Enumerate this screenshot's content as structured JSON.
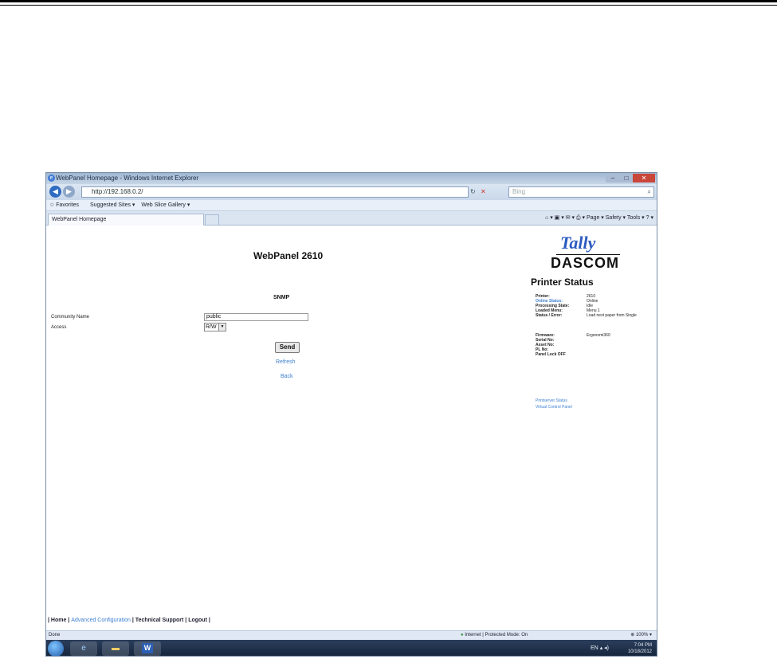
{
  "window": {
    "title": "WebPanel Homepage - Windows Internet Explorer"
  },
  "browser": {
    "address": "http://192.168.0.2/",
    "search_placeholder": "Bing",
    "favorites_label": "Favorites",
    "suggested_sites": "Suggested Sites ▾",
    "web_slice_gallery": "Web Slice Gallery ▾",
    "tab_title": "WebPanel Homepage",
    "command_bar": "Page ▾  Safety ▾  Tools ▾"
  },
  "page": {
    "title": "WebPanel 2610",
    "logo_top": "Tally",
    "logo_bottom": "DASCOM",
    "snmp": {
      "heading": "SNMP",
      "community_label": "Community Name",
      "community_value": "public",
      "access_label": "Access",
      "access_value": "R/W",
      "send_label": "Send",
      "refresh_label": "Refresh",
      "back_label": "Back"
    },
    "printer_status": {
      "heading": "Printer Status",
      "rows": [
        {
          "key": "Printer:",
          "value": "2610"
        },
        {
          "key": "Online Status:",
          "value": "Online"
        },
        {
          "key": "Processing State:",
          "value": "Idle"
        },
        {
          "key": "Loaded Menu:",
          "value": "Menu 1"
        },
        {
          "key": "Status / Error:",
          "value": "Load next paper from Single"
        }
      ],
      "rows2": [
        {
          "key": "Firmware:",
          "value": "Ergonomi360"
        },
        {
          "key": "Serial No:",
          "value": ""
        },
        {
          "key": "Asset No:",
          "value": ""
        },
        {
          "key": "PL No:",
          "value": ""
        },
        {
          "key": "Panel Lock OFF",
          "value": ""
        }
      ],
      "link_printserver": "Printserver Status",
      "link_vcp": "Virtual Control Panel"
    },
    "footer": {
      "home": "| Home |",
      "advanced": "Advanced Configuration",
      "support": "| Technical Support |",
      "logout": "Logout |"
    }
  },
  "statusbar": {
    "left": "Done",
    "zone": "Internet | Protected Mode: On",
    "zoom": "100%"
  },
  "taskbar": {
    "time": "7:04 PM",
    "date": "10/18/2012",
    "lang": "EN"
  }
}
